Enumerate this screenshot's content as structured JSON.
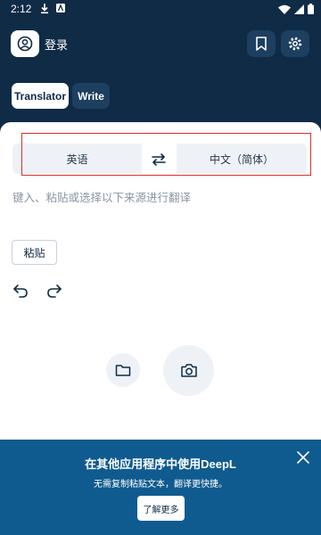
{
  "status_bar": {
    "time": "2:12",
    "icons_left": [
      "download-icon",
      "app-notification-icon"
    ],
    "icons_right": [
      "wifi-icon",
      "cellular-signal-icon",
      "battery-icon"
    ]
  },
  "header": {
    "login_label": "登录",
    "avatar_icon": "user-avatar-icon",
    "bookmark_icon": "bookmark-icon",
    "settings_icon": "gear-icon",
    "tabs": [
      {
        "label": "Translator",
        "active": true
      },
      {
        "label": "Write",
        "active": false
      }
    ]
  },
  "translator": {
    "source_language": "英语",
    "target_language": "中文（简体）",
    "swap_icon": "swap-arrows-icon",
    "input_placeholder": "键入、粘贴或选择以下来源进行翻译",
    "paste_label": "粘贴",
    "undo_icon": "undo-icon",
    "redo_icon": "redo-icon",
    "file_icon": "folder-icon",
    "camera_icon": "camera-icon"
  },
  "banner": {
    "title": "在其他应用程序中使用DeepL",
    "subtitle": "无需复制粘贴文本，翻译更快捷。",
    "button_label": "了解更多",
    "close_icon": "close-icon"
  },
  "colors": {
    "header_bg": "#0f2b46",
    "banner_bg": "#0f5b8f",
    "highlight_border": "#d9302c",
    "lang_box_bg": "#eef2f7"
  }
}
